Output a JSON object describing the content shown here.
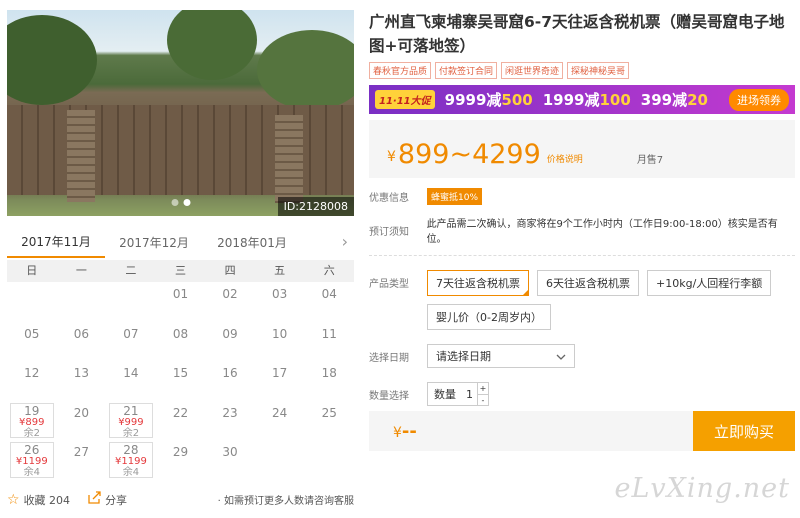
{
  "gallery": {
    "image_id": "ID:2128008"
  },
  "calendar": {
    "months": [
      "2017年11月",
      "2017年12月",
      "2018年01月"
    ],
    "next_icon": "›",
    "weekdays": [
      "日",
      "一",
      "二",
      "三",
      "四",
      "五",
      "六"
    ],
    "cells": [
      {
        "day": ""
      },
      {
        "day": ""
      },
      {
        "day": ""
      },
      {
        "day": "01"
      },
      {
        "day": "02"
      },
      {
        "day": "03"
      },
      {
        "day": "04"
      },
      {
        "day": "05"
      },
      {
        "day": "06"
      },
      {
        "day": "07"
      },
      {
        "day": "08"
      },
      {
        "day": "09"
      },
      {
        "day": "10"
      },
      {
        "day": "11"
      },
      {
        "day": "12"
      },
      {
        "day": "13"
      },
      {
        "day": "14"
      },
      {
        "day": "15"
      },
      {
        "day": "16"
      },
      {
        "day": "17"
      },
      {
        "day": "18"
      },
      {
        "day": "19",
        "price": "¥899",
        "stock": "余2"
      },
      {
        "day": "20"
      },
      {
        "day": "21",
        "price": "¥999",
        "stock": "余2"
      },
      {
        "day": "22"
      },
      {
        "day": "23"
      },
      {
        "day": "24"
      },
      {
        "day": "25"
      },
      {
        "day": "26",
        "price": "¥1199",
        "stock": "余4"
      },
      {
        "day": "27"
      },
      {
        "day": "28",
        "price": "¥1199",
        "stock": "余4"
      },
      {
        "day": "29"
      },
      {
        "day": "30"
      },
      {
        "day": ""
      },
      {
        "day": ""
      }
    ]
  },
  "footer_left": {
    "favorite_icon": "☆",
    "favorite_label": "收藏 204",
    "share_icon": "share-icon",
    "share_label": "分享",
    "note": "· 如需预订更多人数请咨询客服"
  },
  "product": {
    "title": "广州直飞柬埔寨吴哥窟6-7天往返含税机票（赠吴哥窟电子地图+可落地签）",
    "tags": [
      "春秋官方品质",
      "付款签订合同",
      "闲逛世界奇迹",
      "探秘神秘吴哥"
    ]
  },
  "promo": {
    "badge": "11·11大促",
    "deals": [
      {
        "pre": "9999减",
        "num": "500"
      },
      {
        "pre": "1999减",
        "num": "100"
      },
      {
        "pre": "399减",
        "num": "20"
      }
    ],
    "button": "进场领券"
  },
  "price": {
    "currency": "¥",
    "range": "899~4299",
    "explain": "价格说明",
    "sold": "月售7"
  },
  "info": {
    "discount_label": "优惠信息",
    "coupon": "蜂蜜抵10%",
    "booking_label": "预订须知",
    "booking_note": "此产品需二次确认，商家将在9个工作小时内（工作日9:00-18:00）核实是否有位。"
  },
  "options": {
    "type_label": "产品类型",
    "types": [
      "7天往返含税机票",
      "6天往返含税机票",
      "+10kg/人回程行李额",
      "婴儿价（0-2周岁内）"
    ],
    "selected_index": 0,
    "date_label": "选择日期",
    "date_placeholder": "请选择日期",
    "qty_label": "数量选择",
    "qty_field_label": "数量",
    "qty_value": "1",
    "qty_up": "+",
    "qty_down": "-"
  },
  "buy": {
    "currency": "¥",
    "total": "--",
    "button": "立即购买"
  },
  "watermark": "eLvXing.net"
}
